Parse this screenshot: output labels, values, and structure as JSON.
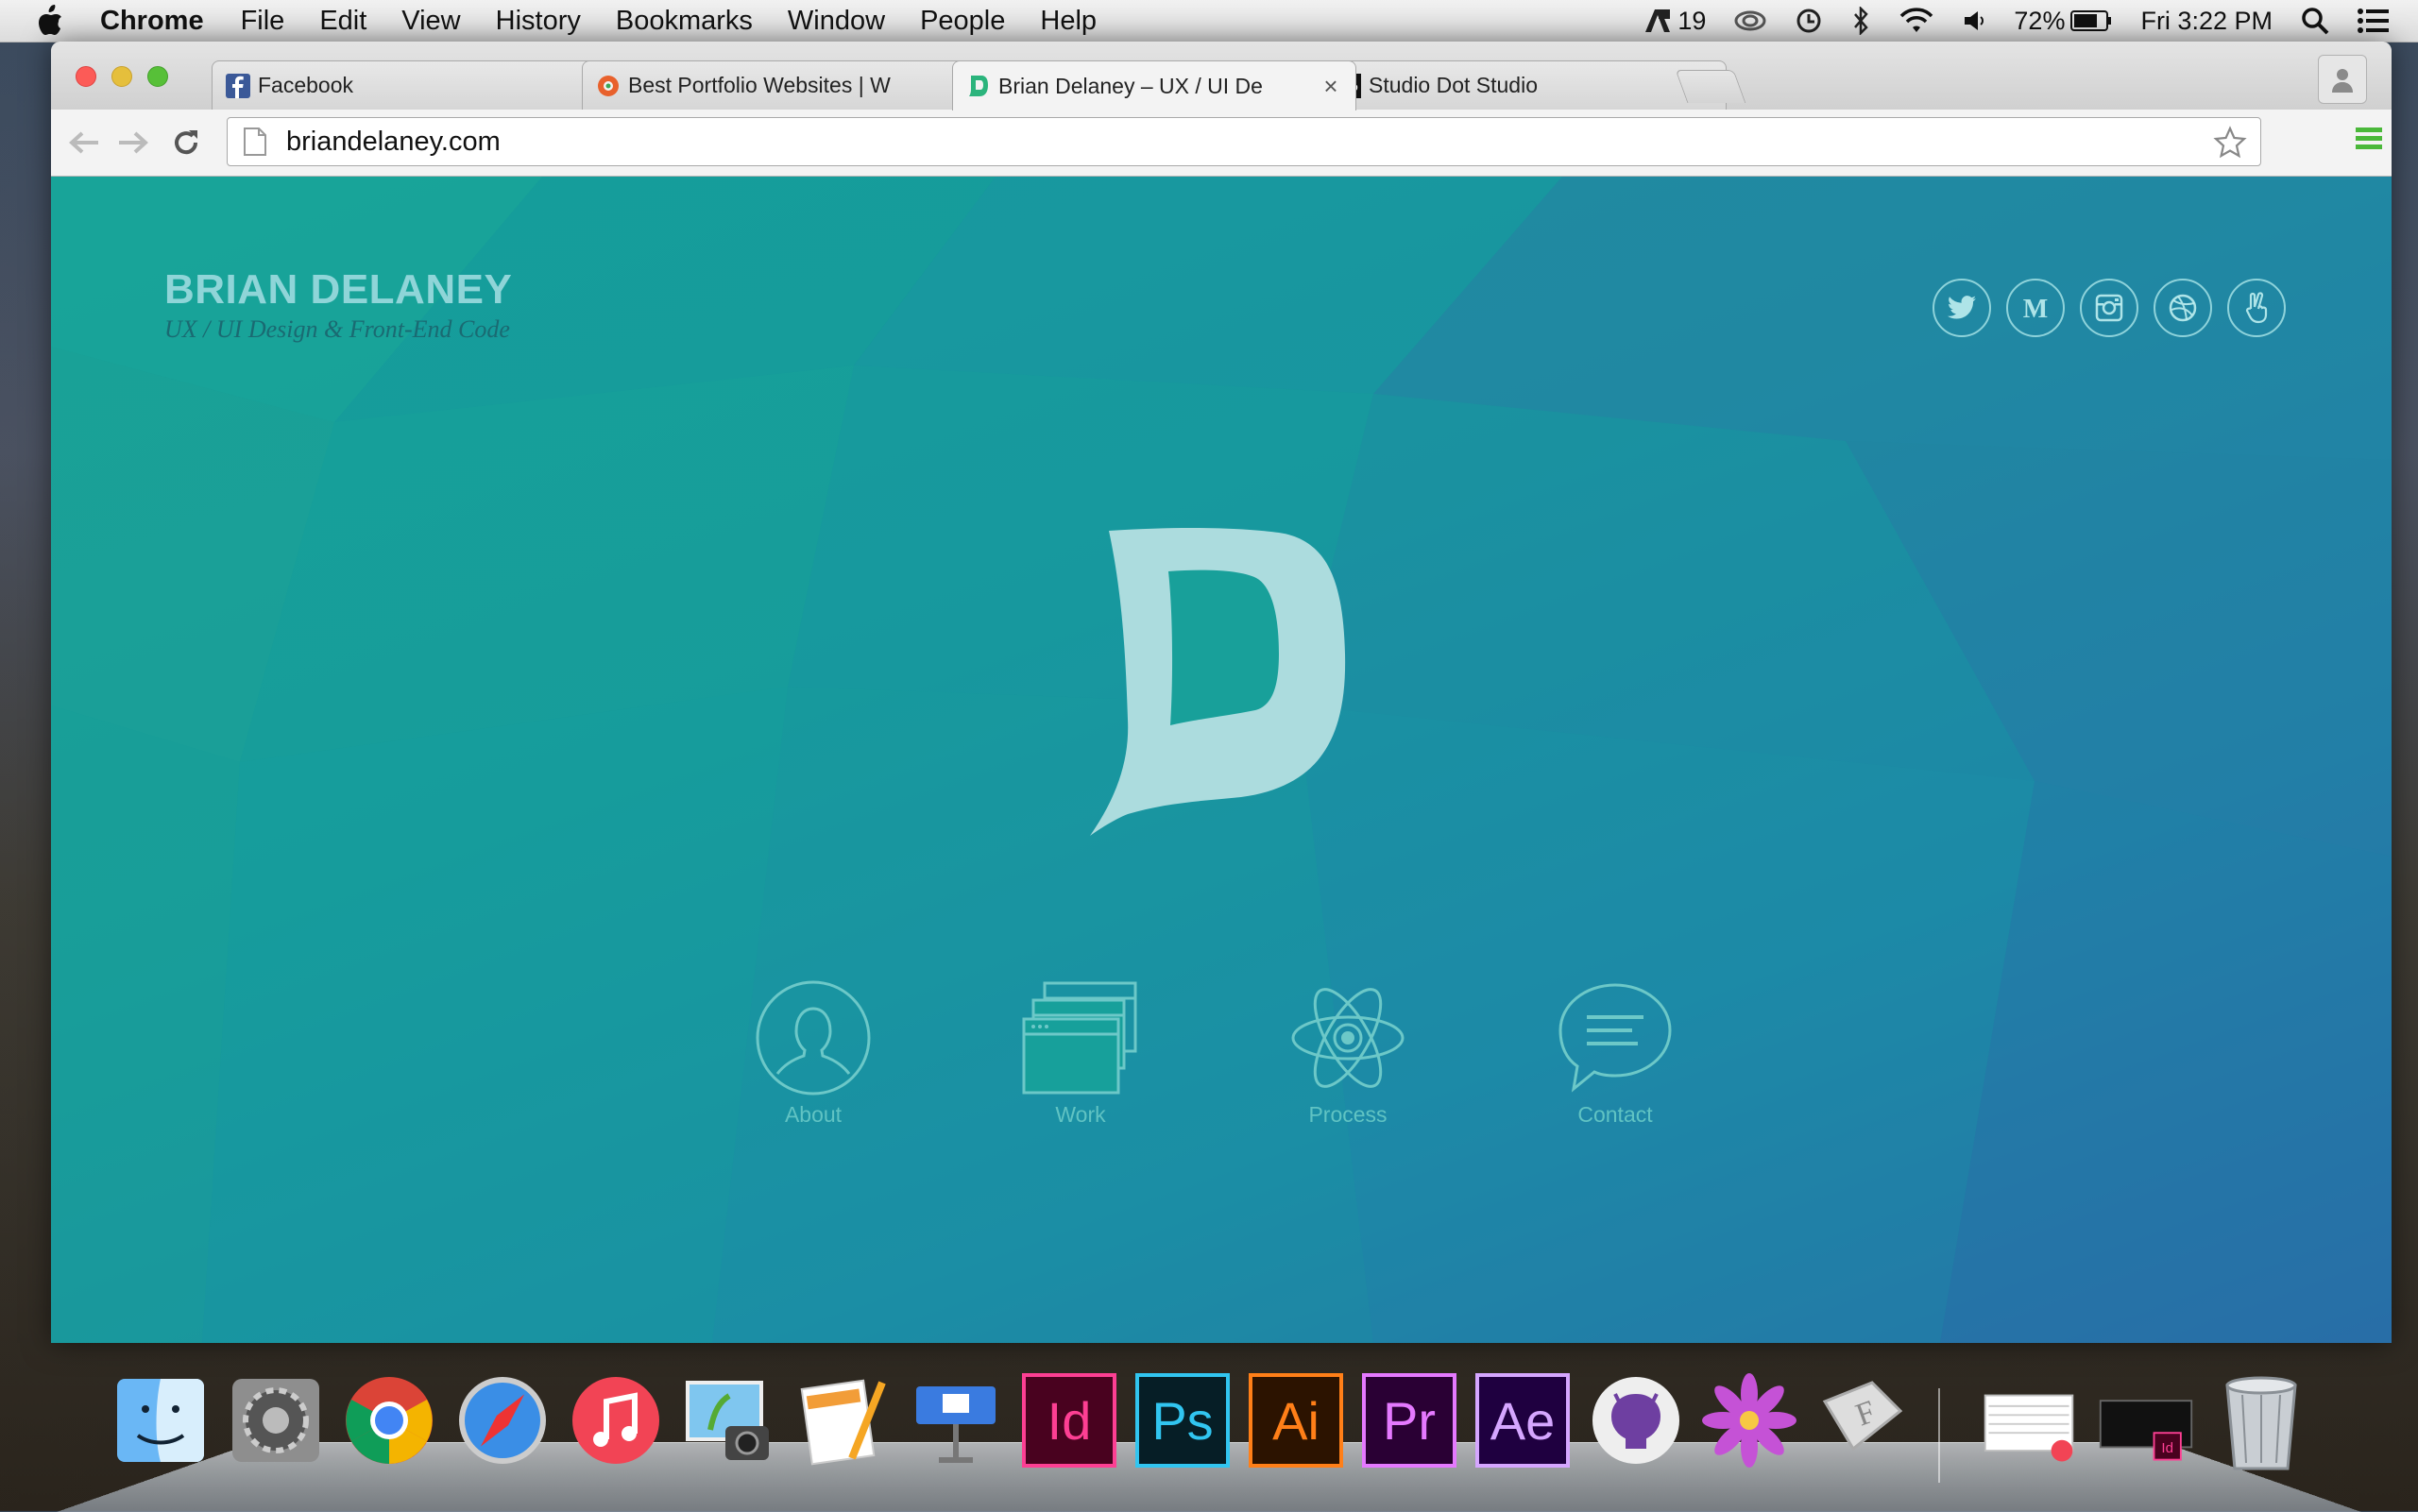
{
  "menubar": {
    "app": "Chrome",
    "items": [
      "File",
      "Edit",
      "View",
      "History",
      "Bookmarks",
      "Window",
      "People",
      "Help"
    ],
    "status": {
      "adobe_count": "19",
      "battery": "72%",
      "clock": "Fri 3:22 PM"
    }
  },
  "browser": {
    "tabs": [
      {
        "title": "Facebook",
        "favicon": "facebook-icon"
      },
      {
        "title": "Best Portfolio Websites | W",
        "favicon": "colorful-gear-icon"
      },
      {
        "title": "Brian Delaney – UX / UI De",
        "favicon": "b-logo-icon",
        "active": true
      },
      {
        "title": "Studio Dot Studio",
        "favicon": "info-icon"
      }
    ],
    "url": "briandelaney.com"
  },
  "page": {
    "name": "BRIAN DELANEY",
    "tagline": "UX / UI Design & Front-End Code",
    "social": [
      "twitter-icon",
      "medium-icon",
      "instagram-icon",
      "dribbble-icon",
      "peace-hand-icon"
    ],
    "nav": [
      {
        "label": "About",
        "icon": "person-icon"
      },
      {
        "label": "Work",
        "icon": "windows-icon"
      },
      {
        "label": "Process",
        "icon": "atom-icon"
      },
      {
        "label": "Contact",
        "icon": "speech-bubble-icon"
      }
    ],
    "colors": {
      "accent": "#b0dfe0",
      "bg_top": "#17a39a",
      "bg_bottom": "#2a6aa8"
    }
  },
  "dock": {
    "apps": [
      "Finder",
      "System Preferences",
      "Chrome",
      "Safari",
      "iTunes",
      "iPhoto",
      "Pages",
      "Keynote",
      "Id",
      "Ps",
      "Ai",
      "Pr",
      "Ae",
      "GitHub",
      "Flower",
      "Font Book",
      "Downloads",
      "Desktop",
      "Trash"
    ]
  }
}
